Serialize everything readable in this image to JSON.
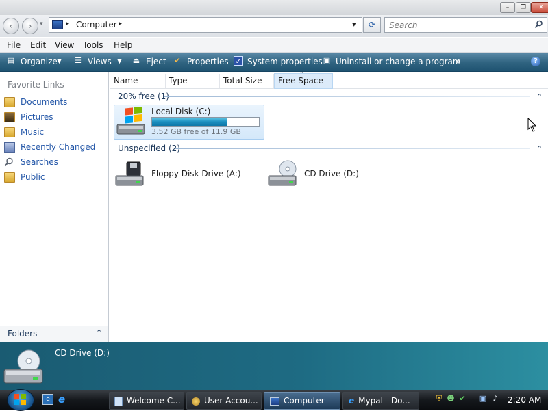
{
  "window": {
    "minimize_glyph": "–",
    "maximize_glyph": "❐",
    "close_glyph": "✕"
  },
  "address": {
    "location": "Computer",
    "separator": "▸",
    "dropdown": "▾",
    "refresh": "⟳"
  },
  "search": {
    "placeholder": "Search",
    "icon": "search-icon"
  },
  "menu": [
    "File",
    "Edit",
    "View",
    "Tools",
    "Help"
  ],
  "toolbar": {
    "organize": "Organize",
    "views": "Views",
    "eject": "Eject",
    "properties": "Properties",
    "system_properties": "System properties",
    "uninstall": "Uninstall or change a program",
    "more": "»",
    "help": "?"
  },
  "favorites": {
    "title": "Favorite Links",
    "items": [
      "Documents",
      "Pictures",
      "Music",
      "Recently Changed",
      "Searches",
      "Public"
    ]
  },
  "folders_label": "Folders",
  "columns": [
    "Name",
    "Type",
    "Total Size",
    "Free Space"
  ],
  "groups": [
    {
      "label": "20% free (1)"
    },
    {
      "label": "Unspecified (2)"
    }
  ],
  "drives": {
    "c": {
      "name": "Local Disk (C:)",
      "free_text": "3.52 GB free of 11.9 GB",
      "used_fraction": 0.705
    },
    "a": {
      "name": "Floppy Disk Drive (A:)"
    },
    "d": {
      "name": "CD Drive (D:)"
    }
  },
  "details": {
    "title": "CD Drive (D:)"
  },
  "taskbar": {
    "tasks": [
      "Welcome C...",
      "User Accou...",
      "Computer",
      "Mypal - Do..."
    ],
    "clock": "2:20 AM"
  },
  "colors": {
    "accent": "#2f6380",
    "link": "#2457a8",
    "progress": "#1b8fc0"
  }
}
